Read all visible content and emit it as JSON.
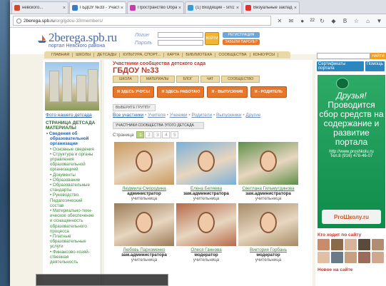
{
  "browser": {
    "tabs": [
      {
        "label": "невского...",
        "fav_color": "#d04a2a",
        "active": false
      },
      {
        "label": "ГБДОУ №33 - Участники с...",
        "fav_color": "#3a7bc8",
        "active": true
      },
      {
        "label": "Пространство Образова...",
        "fav_color": "#c73ab0",
        "active": false
      },
      {
        "label": "(1) Входящие - srn1968@...",
        "fav_color": "#3a9ad9",
        "active": false
      },
      {
        "label": "Визуальные закладки",
        "fav_color": "#e8302a",
        "active": false
      }
    ],
    "url_domain": "2berega.spb.ru",
    "url_path": "/org/gdou-33/members/",
    "badge": "22"
  },
  "header": {
    "logo_name": "2berega.spb.ru",
    "logo_tagline": "портал Невского района",
    "login_label": "Логин",
    "password_label": "Пароль",
    "enter_label": "ВОЙТИ",
    "register_label": "РЕГИСТРАЦИЯ",
    "forgot_label": "ЗАБЫЛИ ПАРОЛЬ?",
    "search_button": "НАЙТИ"
  },
  "menu": [
    "главная",
    "школы",
    "детсады",
    "культура, спорт...",
    "карта",
    "библиотека",
    "сообщества",
    "конкурсы"
  ],
  "left": {
    "photo_link": "Фото нашего детсада",
    "section_title": "Страница детсада",
    "section_sub": "Материалы",
    "items": [
      {
        "t": "• Сведения об",
        "cls": "main"
      },
      {
        "t": "образовательной",
        "cls": "main sub"
      },
      {
        "t": "организации",
        "cls": "main sub"
      },
      {
        "t": "• Основные сведения",
        "cls": "sub"
      },
      {
        "t": "• Структура и органы",
        "cls": "sub"
      },
      {
        "t": "управления",
        "cls": "sub"
      },
      {
        "t": "образовательной",
        "cls": "sub"
      },
      {
        "t": "организацией",
        "cls": "sub"
      },
      {
        "t": "• Документы",
        "cls": "sub"
      },
      {
        "t": "• Образование",
        "cls": "sub"
      },
      {
        "t": "• Образовательные",
        "cls": "sub"
      },
      {
        "t": "стандарты",
        "cls": "sub"
      },
      {
        "t": "• Руководство.",
        "cls": "sub"
      },
      {
        "t": "Педагогический",
        "cls": "sub"
      },
      {
        "t": "состав",
        "cls": "sub"
      },
      {
        "t": "• Материально-техн-",
        "cls": "sub"
      },
      {
        "t": "ическое обеспечение",
        "cls": "sub"
      },
      {
        "t": "и оснащенность",
        "cls": "sub"
      },
      {
        "t": "образовательного",
        "cls": "sub"
      },
      {
        "t": "процесса",
        "cls": "sub"
      },
      {
        "t": "• Платные",
        "cls": "sub"
      },
      {
        "t": "образовательные",
        "cls": "sub"
      },
      {
        "t": "услуги",
        "cls": "sub"
      },
      {
        "t": "• Финансово-хозяй-",
        "cls": "sub"
      },
      {
        "t": "ственная деятельность",
        "cls": "sub"
      }
    ]
  },
  "center": {
    "title": "Участники сообщества детского сада",
    "name": "ГБДОУ №33",
    "tabs": [
      "школа",
      "материалы",
      "блог",
      "чат",
      "сообщество"
    ],
    "buttons": [
      "я здесь учусь!",
      "я здесь работаю",
      "я - выпускник",
      "я - родитель"
    ],
    "group_tab": "выберите группу",
    "filters": [
      "Все участники",
      "Учителя",
      "Ученики",
      "Родители",
      "Выпускники",
      "Другие"
    ],
    "members_tab": "участники сообщества этого детсада",
    "pager_label": "Страница",
    "pages": [
      "1",
      "2",
      "3",
      "4",
      "5"
    ],
    "current_page": "1",
    "members": [
      {
        "name": "Людмила Смородина",
        "role": "администратор",
        "sub": "учительница",
        "bg": "#c9995c"
      },
      {
        "name": "Елена Беляева",
        "role": "зам.администратора",
        "sub": "учительница",
        "bg": "#7ab0d8"
      },
      {
        "name": "Светлана Гильмутдинова",
        "role": "зам.администратора",
        "sub": "учительница",
        "bg": "#5f8f4a"
      },
      {
        "name": "Любовь Пархоменко",
        "role": "зам.администратора",
        "sub": "учительница",
        "bg": "#9b7b57"
      },
      {
        "name": "Олеся Ганнова",
        "role": "модератор",
        "sub": "учительница",
        "bg": "#b56a4a"
      },
      {
        "name": "Виктория Горбань",
        "role": "модератор",
        "sub": "учительница",
        "bg": "#a58a66"
      }
    ]
  },
  "right": {
    "btn1": "Сертификаты портала",
    "btn2": "Помощь",
    "ad_line1": "Друзья!",
    "ad_line2": "Проводится сбор средств на содержание и развитие портала",
    "ad_url": "http://www.proshkolu.ru",
    "ad_phone": "Тел.8 (916) 478-46-07",
    "ad_brand": "ProШколу.ru",
    "who_title": "Кто ходит по сайту",
    "new_title": "Новое на сайте",
    "avatar_colors": [
      "#c98b6b",
      "#8a6a4a",
      "#d8b39a",
      "#5a4a3a",
      "#b28c70",
      "#e0c0a0",
      "#6a7a8a",
      "#c7a080",
      "#9a6a5a",
      "#d0a890"
    ]
  }
}
